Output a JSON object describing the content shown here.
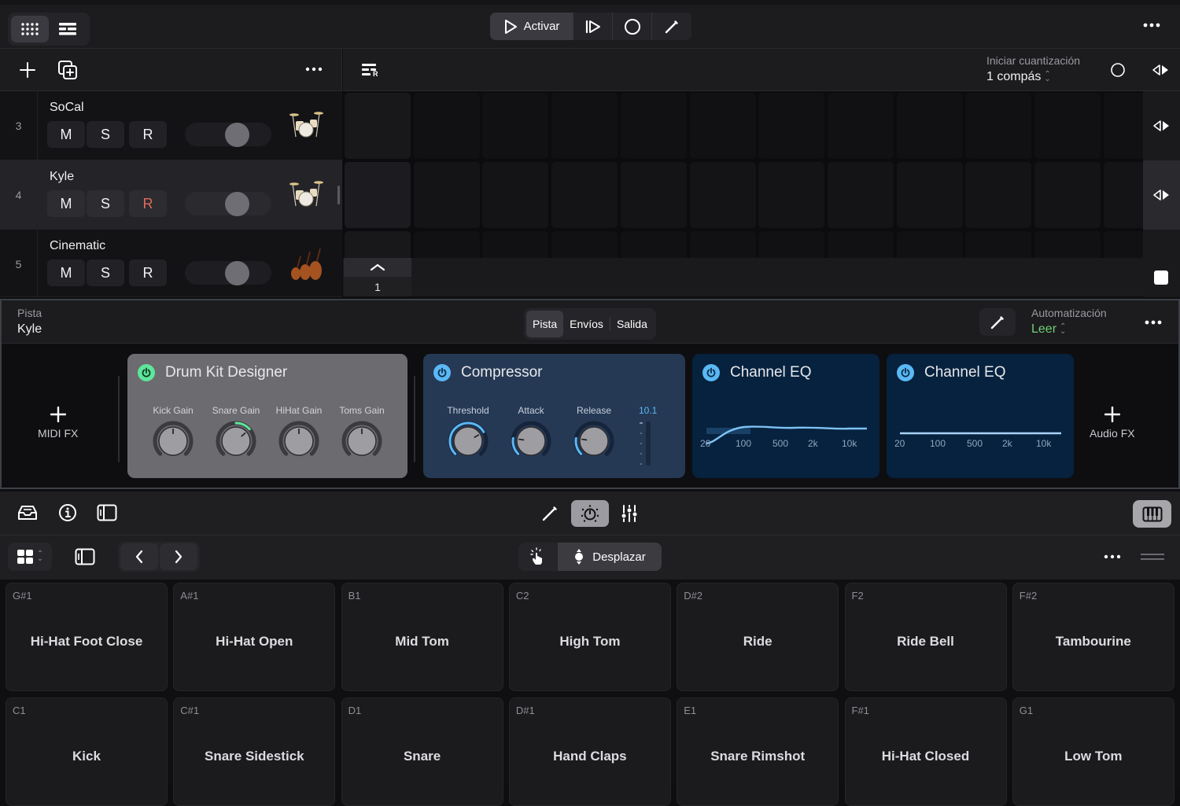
{
  "topbar": {
    "view_modes": [
      {
        "icon": "grid-view-icon",
        "active": true
      },
      {
        "icon": "tracks-view-icon",
        "active": false
      }
    ],
    "play_label": "Activar",
    "more_icon": "more-icon"
  },
  "tracks_header": {
    "add_icon": "plus-icon",
    "duplicate_icon": "duplicate-icon",
    "more_icon": "more-icon",
    "scene_icon": "scene-list-icon"
  },
  "quantize": {
    "label": "Iniciar cuantización",
    "value": "1 compás"
  },
  "tracks": [
    {
      "number": "3",
      "name": "SoCal",
      "mute": "M",
      "solo": "S",
      "record": "R",
      "armed": false,
      "selected": false,
      "volume": 0.65,
      "instrument": "drum-kit"
    },
    {
      "number": "4",
      "name": "Kyle",
      "mute": "M",
      "solo": "S",
      "record": "R",
      "armed": true,
      "selected": true,
      "volume": 0.65,
      "instrument": "drum-kit"
    },
    {
      "number": "5",
      "name": "Cinematic",
      "mute": "M",
      "solo": "S",
      "record": "R",
      "armed": false,
      "selected": false,
      "volume": 0.65,
      "instrument": "strings"
    }
  ],
  "scene": {
    "label": "1"
  },
  "inspector": {
    "track_label": "Pista",
    "track_name": "Kyle",
    "tabs": [
      {
        "label": "Pista",
        "active": true
      },
      {
        "label": "Envíos",
        "active": false
      },
      {
        "label": "Salida",
        "active": false
      }
    ],
    "automation_label": "Automatización",
    "automation_value": "Leer",
    "midi_fx_label": "MIDI FX",
    "audio_fx_label": "Audio FX",
    "colors": {
      "instrument_power": "#5ee59a",
      "fx_power": "#5ab8f5",
      "automation_read": "#6fcf73"
    }
  },
  "plugins": {
    "drum_kit": {
      "title": "Drum Kit Designer",
      "knobs": [
        {
          "label": "Kick Gain",
          "value": 0.5
        },
        {
          "label": "Snare Gain",
          "value": 0.68
        },
        {
          "label": "HiHat Gain",
          "value": 0.5
        },
        {
          "label": "Toms Gain",
          "value": 0.5
        }
      ]
    },
    "compressor": {
      "title": "Compressor",
      "knobs": [
        {
          "label": "Threshold",
          "value": 0.72
        },
        {
          "label": "Attack",
          "value": 0.2
        },
        {
          "label": "Release",
          "value": 0.2
        }
      ],
      "meter_value": "10.1"
    },
    "eq1": {
      "title": "Channel EQ",
      "freq_labels": [
        "20",
        "100",
        "500",
        "2k",
        "10k"
      ],
      "curve": "low-cut"
    },
    "eq2": {
      "title": "Channel EQ",
      "freq_labels": [
        "20",
        "100",
        "500",
        "2k",
        "10k"
      ],
      "curve": "flat"
    }
  },
  "editor_toolbar": {
    "left_icons": [
      "library-icon",
      "info-icon",
      "inspector-toggle-icon"
    ],
    "center_tools": [
      {
        "icon": "pencil-icon",
        "active": false
      },
      {
        "icon": "knob-icon",
        "active": true
      },
      {
        "icon": "mixer-icon",
        "active": false
      }
    ],
    "keyboard_icon": "piano-keys-icon"
  },
  "pad_toolbar": {
    "mode_touch_icon": "touch-icon",
    "mode_scroll_label": "Desplazar",
    "more_icon": "more-icon",
    "resize_icon": "drag-handle-icon"
  },
  "pads": [
    {
      "note": "G#1",
      "name": "Hi-Hat Foot Close"
    },
    {
      "note": "A#1",
      "name": "Hi-Hat Open"
    },
    {
      "note": "B1",
      "name": "Mid Tom"
    },
    {
      "note": "C2",
      "name": "High Tom"
    },
    {
      "note": "D#2",
      "name": "Ride"
    },
    {
      "note": "F2",
      "name": "Ride Bell"
    },
    {
      "note": "F#2",
      "name": "Tambourine"
    },
    {
      "note": "C1",
      "name": "Kick"
    },
    {
      "note": "C#1",
      "name": "Snare Sidestick"
    },
    {
      "note": "D1",
      "name": "Snare"
    },
    {
      "note": "D#1",
      "name": "Hand Claps"
    },
    {
      "note": "E1",
      "name": "Snare Rimshot"
    },
    {
      "note": "F#1",
      "name": "Hi-Hat Closed"
    },
    {
      "note": "G1",
      "name": "Low Tom"
    }
  ]
}
